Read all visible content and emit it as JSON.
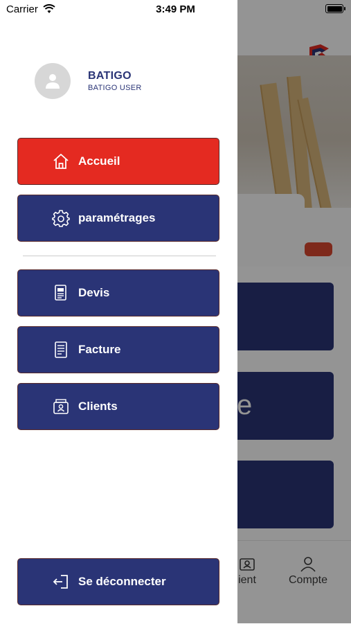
{
  "status_bar": {
    "carrier": "Carrier",
    "time": "3:49 PM"
  },
  "drawer": {
    "user": {
      "name": "BATIGO",
      "role": "BATIGO USER"
    },
    "menu": [
      {
        "label": "Accueil",
        "icon": "home-icon",
        "color": "#e42a21"
      },
      {
        "label": "paramétrages",
        "icon": "gear-icon",
        "color": "#2a3476"
      },
      {
        "label": "Devis",
        "icon": "document-icon",
        "color": "#2a3476"
      },
      {
        "label": "Facture",
        "icon": "invoice-icon",
        "color": "#2a3476"
      },
      {
        "label": "Clients",
        "icon": "clients-icon",
        "color": "#2a3476"
      }
    ],
    "logout_label": "Se déconnecter"
  },
  "background": {
    "card_text_fragment": "e",
    "tabs": [
      {
        "label": "ient",
        "icon": "client-icon"
      },
      {
        "label": "Compte",
        "icon": "person-icon"
      }
    ]
  },
  "colors": {
    "primary_blue": "#2a3476",
    "accent_red": "#e42a21",
    "overlay": "rgba(0,0,0,0.42)"
  }
}
